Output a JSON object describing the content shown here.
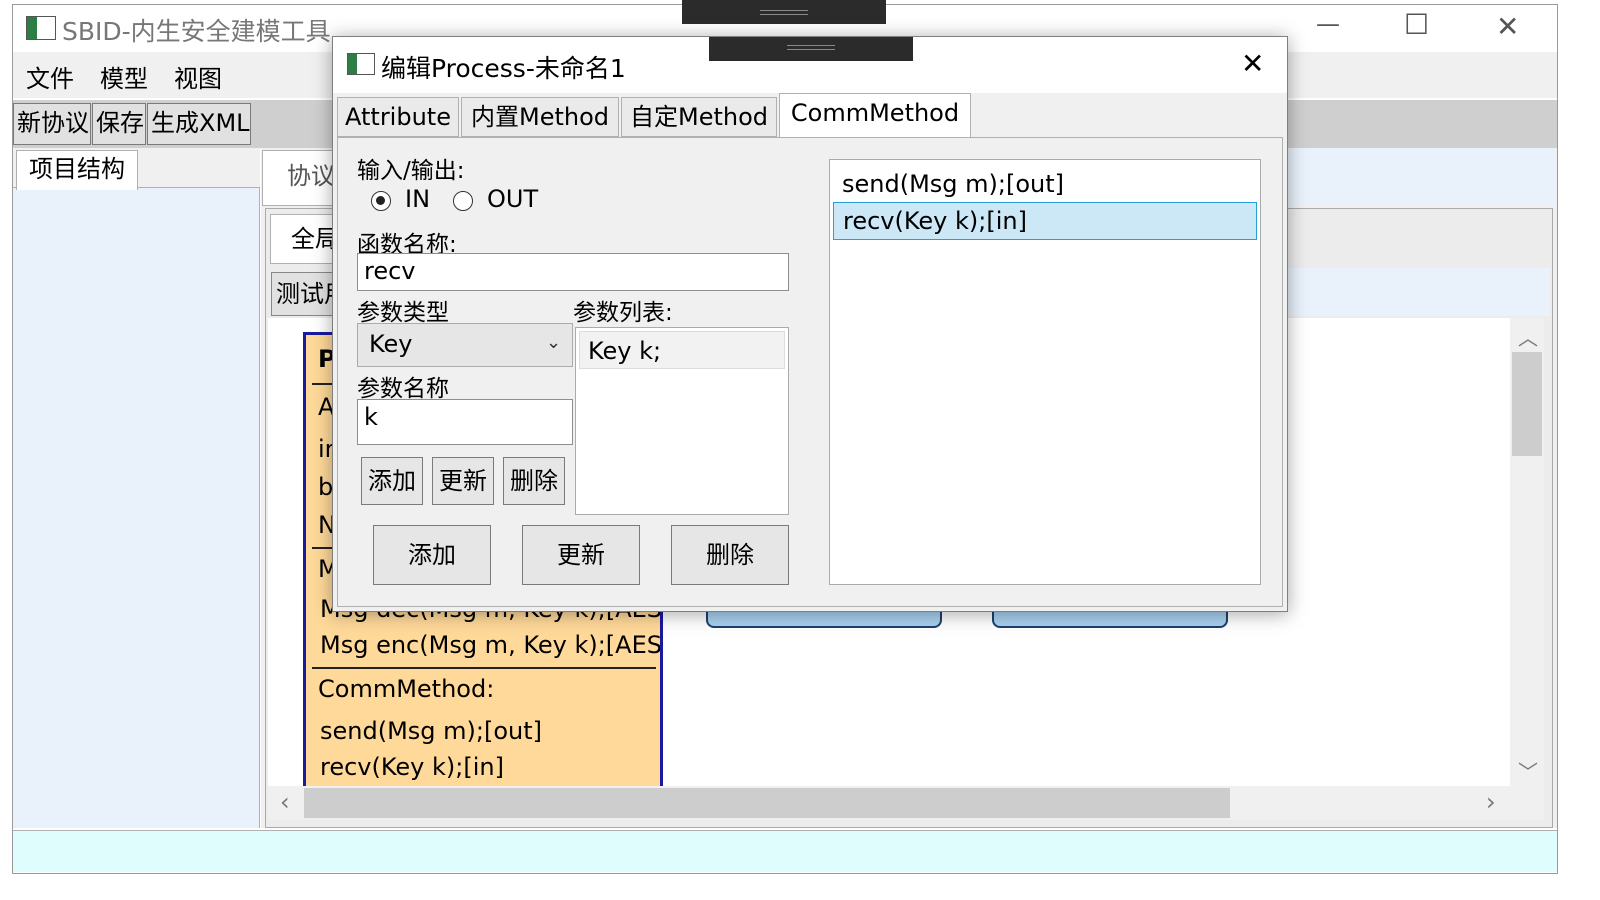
{
  "window": {
    "title": "SBID-内生安全建模工具",
    "controls": {
      "minimize": "—",
      "maximize": "☐",
      "close": "✕"
    }
  },
  "menu": [
    "文件",
    "模型",
    "视图"
  ],
  "toolbar": [
    "新协议",
    "保存",
    "生成XML"
  ],
  "left_panel": {
    "tab": "项目结构"
  },
  "content": {
    "tab": "协议",
    "subtab": "全局",
    "test_button": "测试用",
    "process_box": {
      "header_partial": "P",
      "attr_partial": [
        "A",
        "ir",
        "b",
        "N"
      ],
      "method_partial": "M",
      "method_overlap": "Msg dec(Msg m, Key k);[AES]",
      "method_visible": "Msg enc(Msg m, Key k);[AES]",
      "comm_header": "CommMethod:",
      "comm_methods": [
        "send(Msg m);[out]",
        "recv(Key k);[in]"
      ]
    }
  },
  "dialog": {
    "title": "编辑Process-未命名1",
    "close": "✕",
    "tabs": [
      "Attribute",
      "内置Method",
      "自定Method",
      "CommMethod"
    ],
    "active_tab": 3,
    "io_label": "输入/输出:",
    "radio_in": "IN",
    "radio_out": "OUT",
    "radio_selected": "IN",
    "func_name_label": "函数名称:",
    "func_name_value": "recv",
    "param_type_label": "参数类型",
    "param_type_value": "Key",
    "param_list_label": "参数列表:",
    "param_list": [
      "Key k;"
    ],
    "param_name_label": "参数名称",
    "param_name_value": "k",
    "small_buttons": [
      "添加",
      "更新",
      "删除"
    ],
    "big_buttons": [
      "添加",
      "更新",
      "删除"
    ],
    "method_list": [
      "send(Msg m);[out]",
      "recv(Key k);[in]"
    ],
    "method_selected": 1
  }
}
